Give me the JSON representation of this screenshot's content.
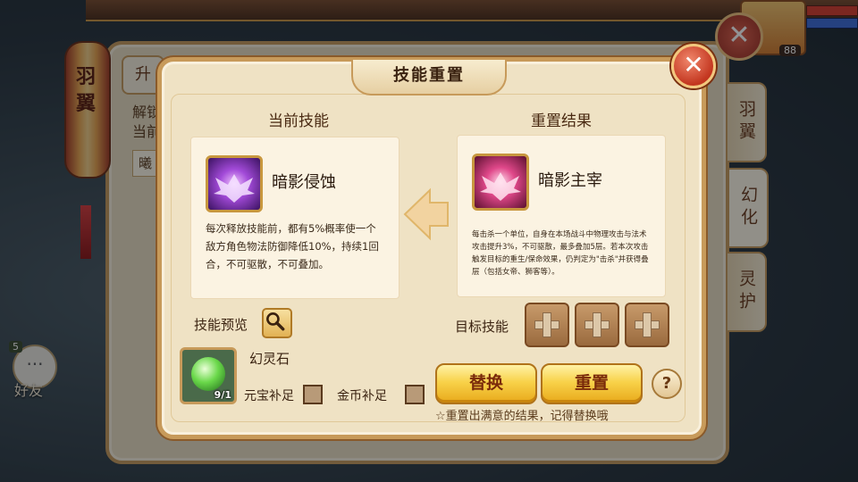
{
  "background": {
    "lantern_text": "羽翼",
    "tab_top": "升",
    "text_1": "解锁",
    "text_2": "当前",
    "input_value": "曦",
    "friends_label": "好友",
    "friends_count": "5",
    "player_level": "88",
    "side_tabs": [
      "羽翼",
      "幻化",
      "灵护"
    ]
  },
  "dialog": {
    "title": "技能重置",
    "current": {
      "heading": "当前技能",
      "skill_name": "暗影侵蚀",
      "description": "每次释放技能前，都有5%概率使一个敌方角色物法防御降低10%，持续1回合，不可驱散，不可叠加。"
    },
    "result": {
      "heading": "重置结果",
      "skill_name": "暗影主宰",
      "description": "每击杀一个单位，自身在本场战斗中物理攻击与法术攻击提升3%，不可驱散，最多叠加5层。若本次攻击触发目标的重生/保命效果，仍判定为\"击杀\"并获得叠层（包括女帝、狮客等）。"
    },
    "preview_label": "技能预览",
    "target_label": "目标技能",
    "item": {
      "name": "幻灵石",
      "count": "9/1"
    },
    "yuanbao_label": "元宝补足",
    "gold_label": "金币补足",
    "replace_button": "替换",
    "reset_button": "重置",
    "help": "?",
    "tip": "☆重置出满意的结果，记得替换哦",
    "close": "✕"
  },
  "icons": {
    "close": "close-icon",
    "search": "search-icon",
    "plus": "plus-icon",
    "arrow": "arrow-left-icon",
    "help": "help-icon",
    "chat": "chat-bubble-icon"
  }
}
